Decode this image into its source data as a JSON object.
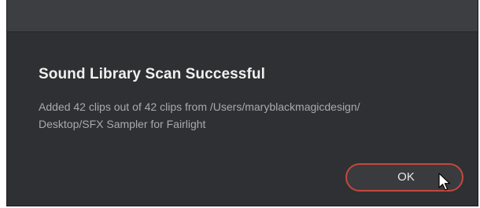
{
  "dialog": {
    "title": "Sound Library Scan Successful",
    "message_line1": "Added 42 clips out of 42 clips from /Users/maryblackmagicdesign/",
    "message_line2": "Desktop/SFX Sampler for Fairlight",
    "ok_label": "OK"
  },
  "colors": {
    "background": "#2f3033",
    "title_bar": "#3d3e41",
    "button_border": "#c2493e"
  },
  "icons": {
    "cursor": "mouse-pointer-icon"
  }
}
